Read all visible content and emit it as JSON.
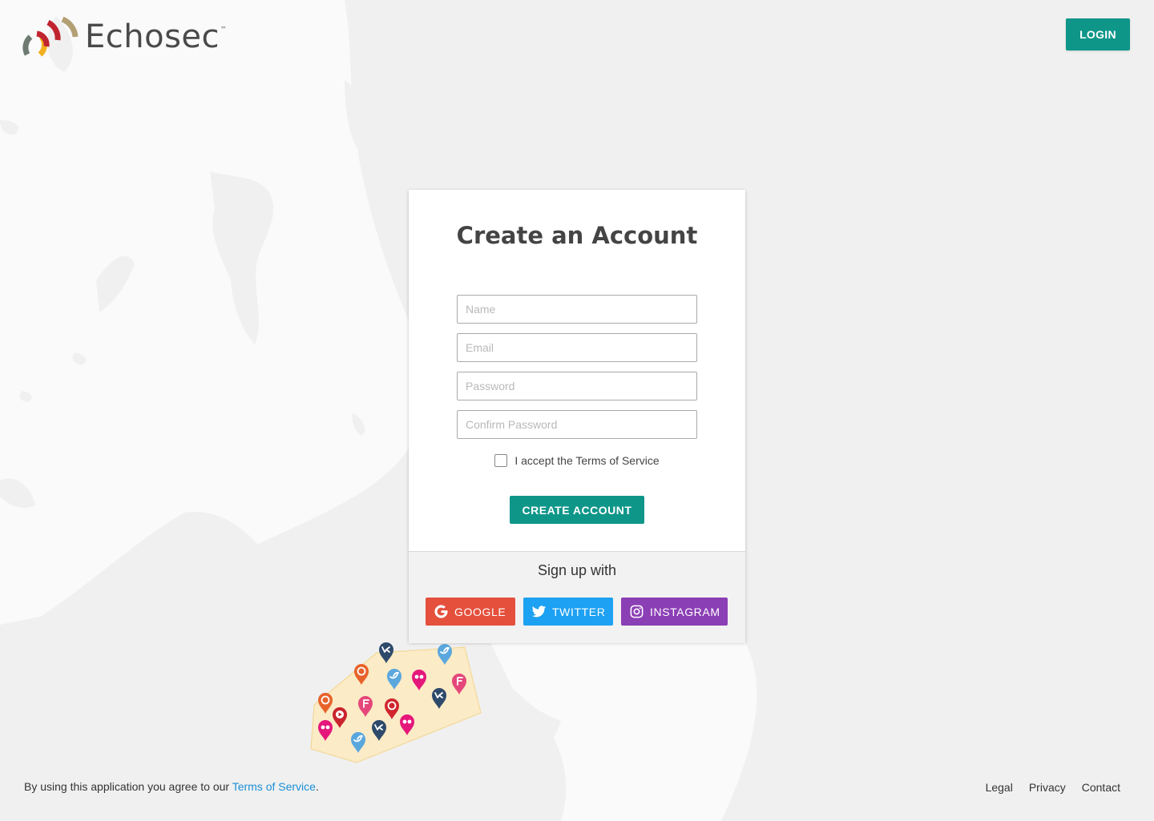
{
  "header": {
    "brand": "Echosec",
    "brand_mark": "™",
    "login_label": "LOGIN"
  },
  "colors": {
    "accent": "#0e9689",
    "google": "#e4503c",
    "twitter": "#1da1f2",
    "instagram": "#8b3fb5",
    "link": "#1a8fd6"
  },
  "card": {
    "title": "Create an Account",
    "fields": {
      "name_placeholder": "Name",
      "email_placeholder": "Email",
      "password_placeholder": "Password",
      "confirm_placeholder": "Confirm Password"
    },
    "tos_label": "I accept the Terms of Service",
    "submit_label": "CREATE ACCOUNT"
  },
  "signup": {
    "title": "Sign up with",
    "google_label": "GOOGLE",
    "twitter_label": "TWITTER",
    "instagram_label": "INSTAGRAM"
  },
  "map": {
    "pin_icons": [
      "vk-icon",
      "reddit-icon",
      "twitter-icon",
      "flickr-icon",
      "foursquare-icon",
      "youtube-icon",
      "weibo-icon"
    ]
  },
  "footer": {
    "agree_prefix": "By using this application you agree to our ",
    "tos_link": "Terms of Service",
    "agree_suffix": ".",
    "links": [
      "Legal",
      "Privacy",
      "Contact"
    ]
  }
}
